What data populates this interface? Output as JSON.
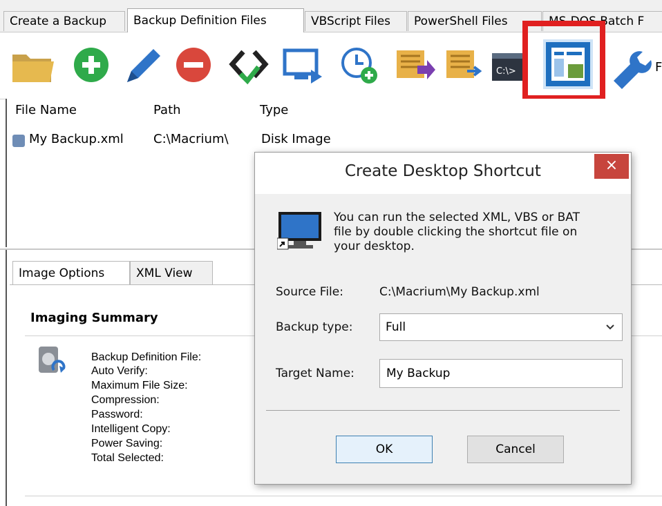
{
  "tabs": [
    "Create a Backup",
    "Backup Definition Files",
    "VBScript Files",
    "PowerShell Files",
    "MS-DOS Batch F"
  ],
  "toolbar": {
    "icons": [
      "folder-open-icon",
      "add-icon",
      "edit-pencil-icon",
      "remove-icon",
      "verify-xml-icon",
      "run-now-icon",
      "schedule-icon",
      "generate-vbscript-icon",
      "generate-powershell-icon",
      "generate-batch-icon",
      "create-shortcut-icon",
      "tools-wrench-icon"
    ],
    "overflow_label": "F"
  },
  "list": {
    "columns": [
      "File Name",
      "Path",
      "Type"
    ],
    "rows": [
      {
        "name": "My Backup.xml",
        "path": "C:\\Macrium\\",
        "type": "Disk Image"
      }
    ]
  },
  "lower_tabs": [
    "Image Options",
    "XML View"
  ],
  "summary": {
    "heading": "Imaging Summary",
    "labels": [
      "Backup Definition File:",
      "Auto Verify:",
      "Maximum File Size:",
      "Compression:",
      "Password:",
      "Intelligent Copy:",
      "Power Saving:",
      "Total Selected:"
    ]
  },
  "dialog": {
    "title": "Create Desktop Shortcut",
    "close_label": "×",
    "description_lines": [
      "You can run the selected XML, VBS or BAT",
      "file by double clicking the shortcut file on",
      "your desktop."
    ],
    "source_label": "Source File:",
    "source_value": "C:\\Macrium\\My Backup.xml",
    "backup_type_label": "Backup type:",
    "backup_type_value": "Full",
    "target_label": "Target Name:",
    "target_value": "My Backup",
    "ok_label": "OK",
    "cancel_label": "Cancel"
  },
  "colors": {
    "highlight": "#e02020",
    "close_button": "#c7453d",
    "dialog_bg": "#f0f0f0"
  }
}
